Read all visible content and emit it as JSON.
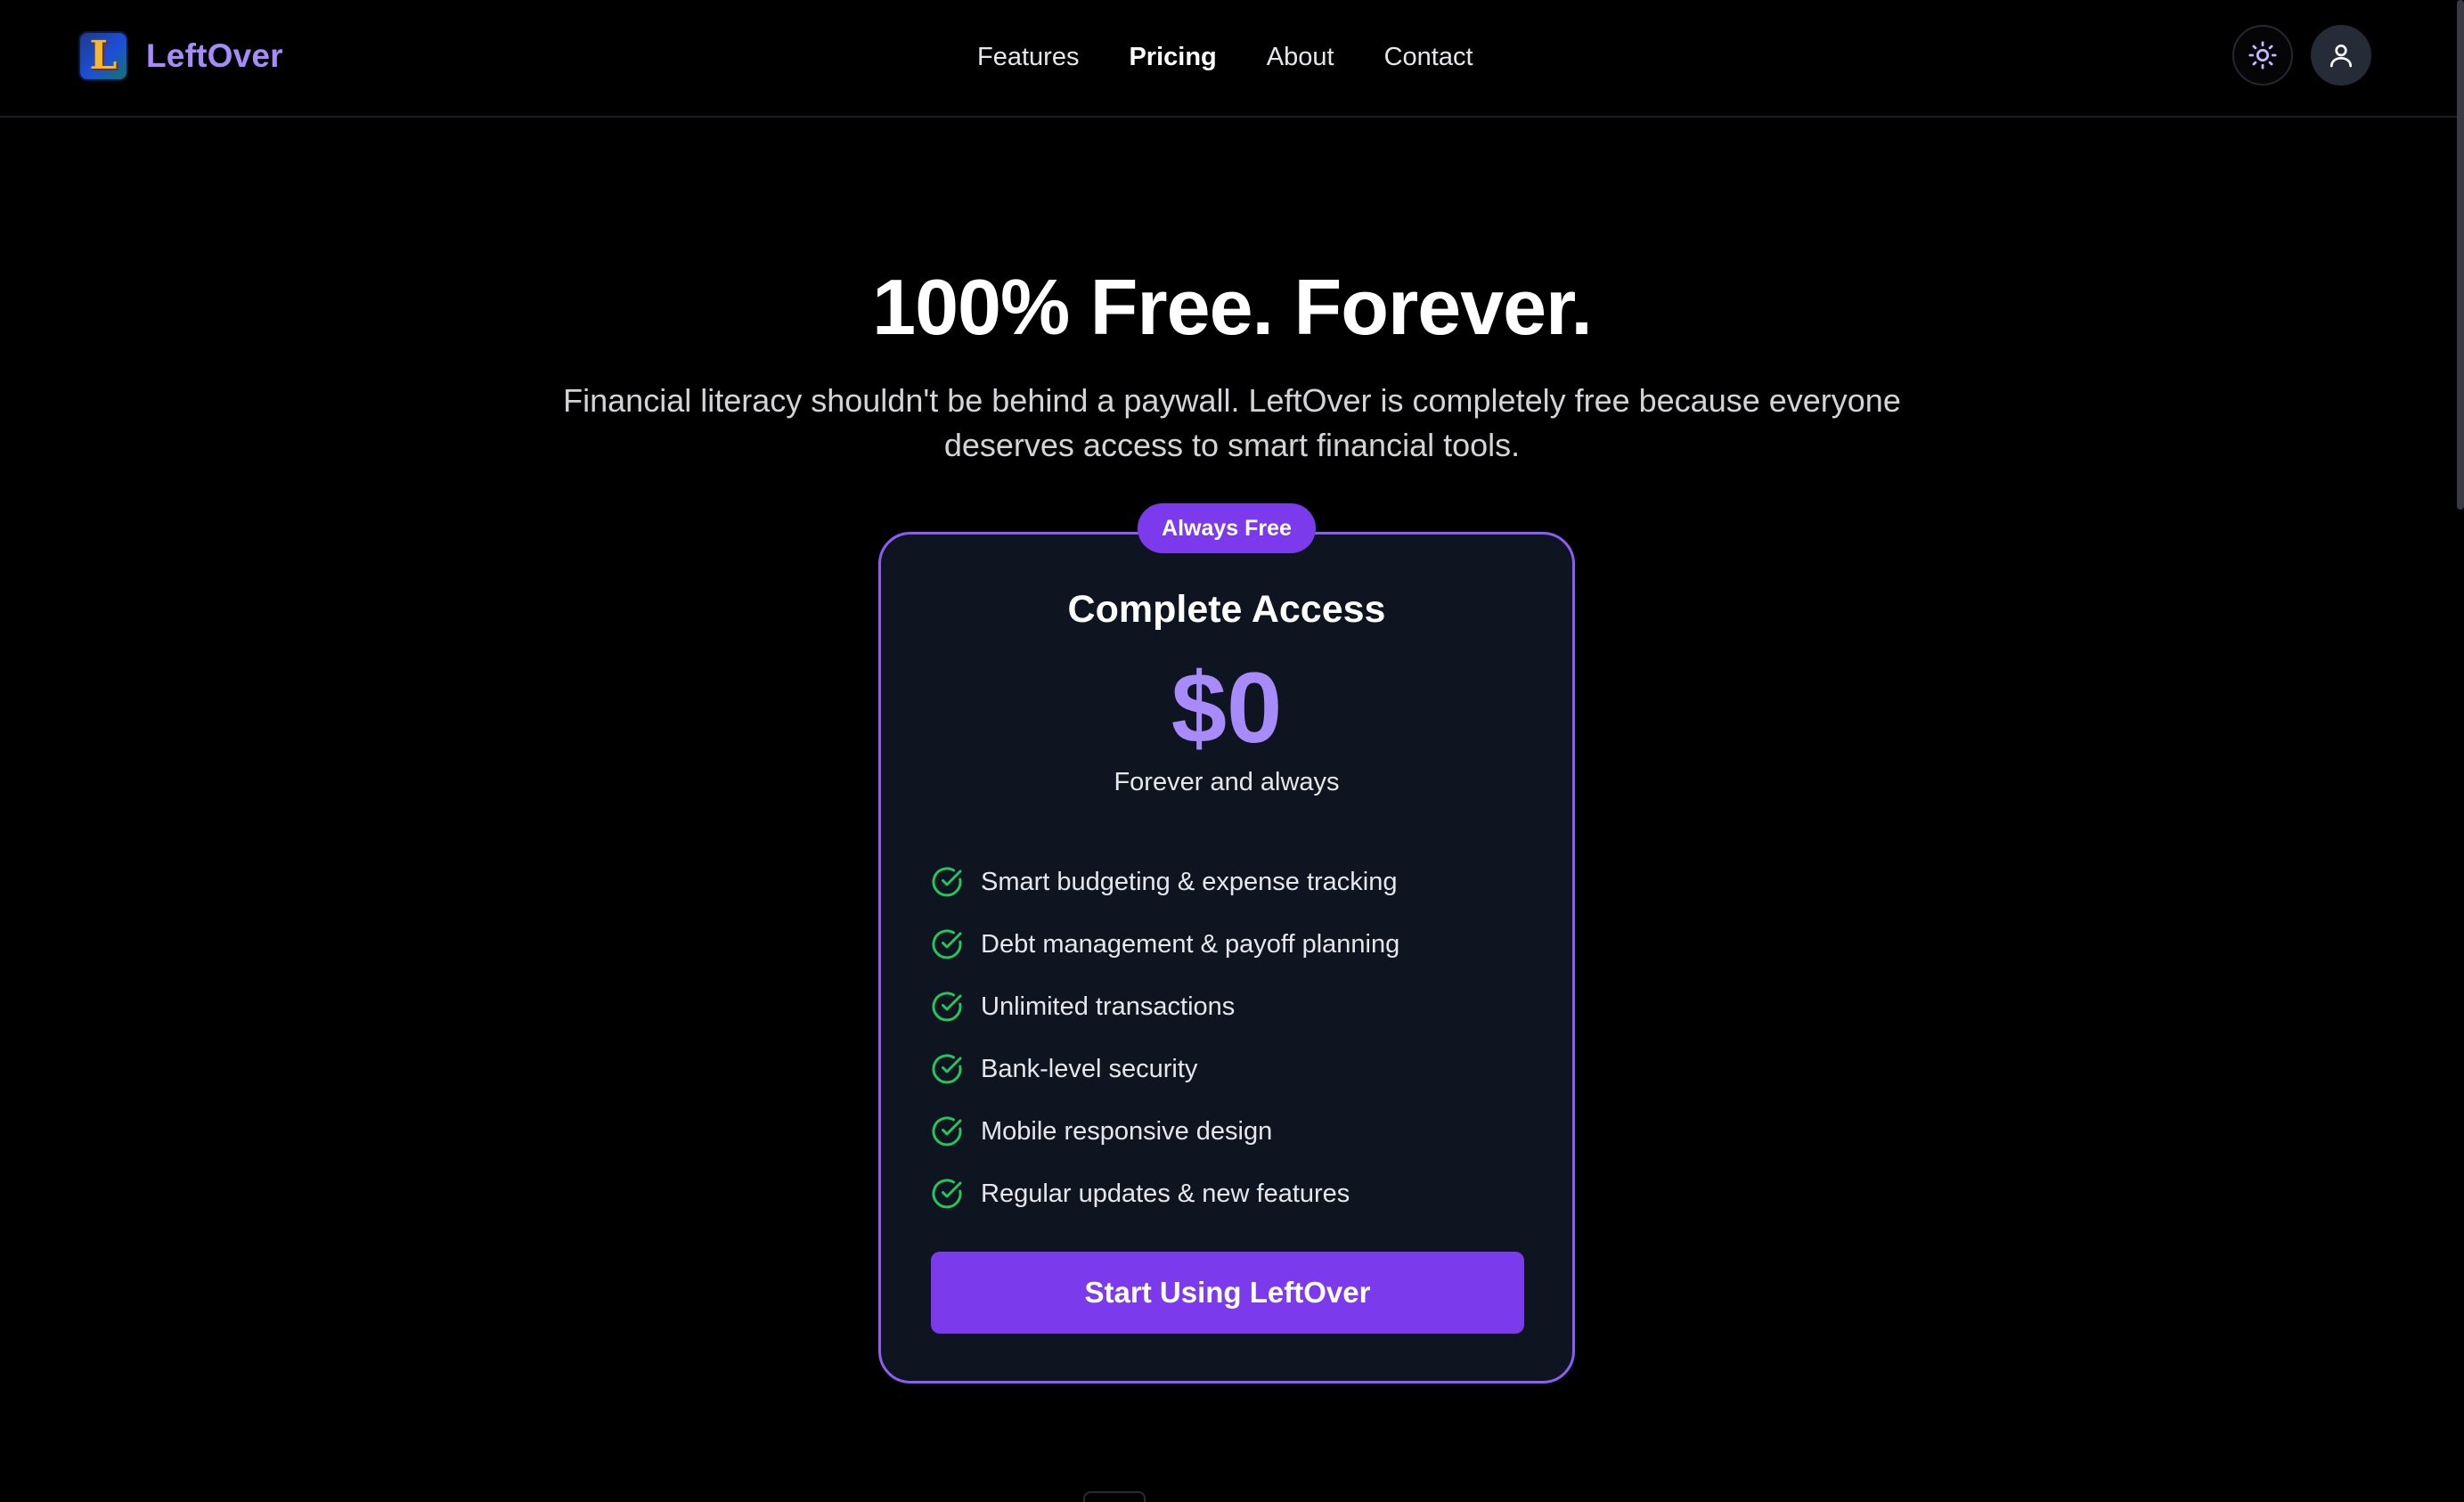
{
  "brand": {
    "logo_letter": "L",
    "name": "LeftOver"
  },
  "nav": {
    "items": [
      {
        "label": "Features",
        "active": false
      },
      {
        "label": "Pricing",
        "active": true
      },
      {
        "label": "About",
        "active": false
      },
      {
        "label": "Contact",
        "active": false
      }
    ]
  },
  "header_actions": {
    "theme_icon": "sun-icon",
    "account_icon": "user-icon"
  },
  "hero": {
    "title": "100% Free. Forever.",
    "subtitle": "Financial literacy shouldn't be behind a paywall. LeftOver is completely free because everyone deserves access to smart financial tools."
  },
  "plan": {
    "badge": "Always Free",
    "title": "Complete Access",
    "price": "$0",
    "price_note": "Forever and always",
    "features": [
      "Smart budgeting & expense tracking",
      "Debt management & payoff planning",
      "Unlimited transactions",
      "Bank-level security",
      "Mobile responsive design",
      "Regular updates & new features"
    ],
    "cta_label": "Start Using LeftOver"
  },
  "colors": {
    "accent": "#7c3aed",
    "accent_light": "#a78bfa",
    "check": "#22c55e",
    "card_bg": "#0f1421"
  }
}
